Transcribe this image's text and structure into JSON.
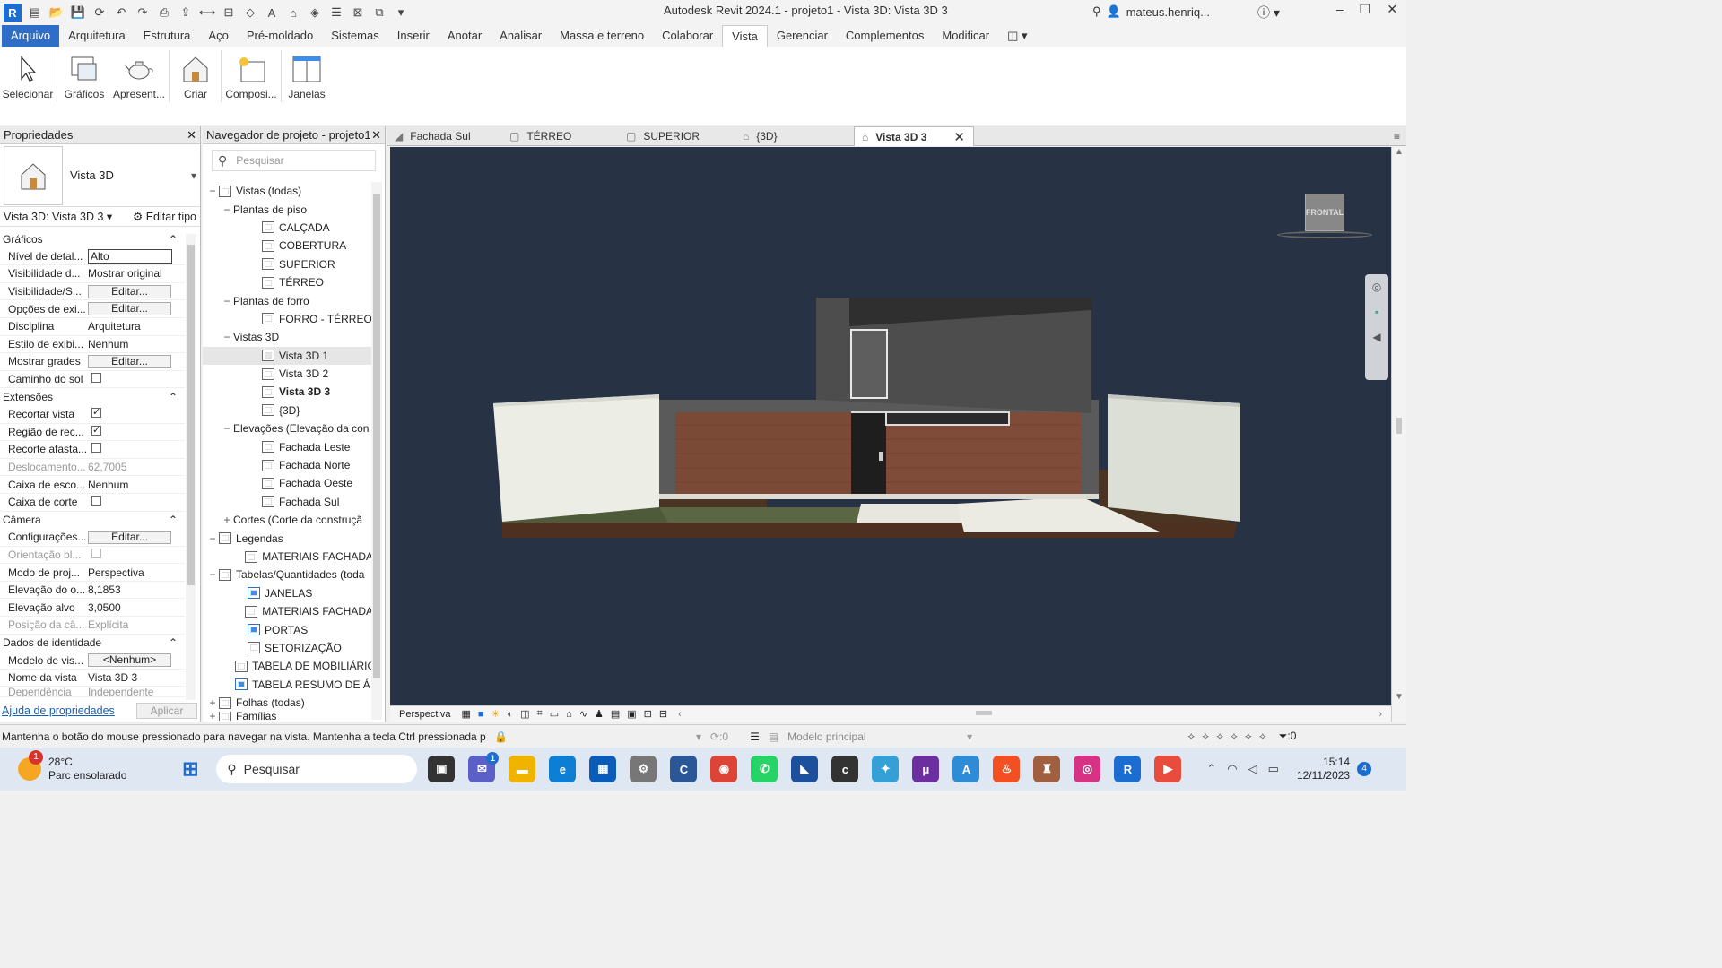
{
  "app": {
    "title": "Autodesk Revit 2024.1 - projeto1 - Vista 3D: Vista 3D 3",
    "user": "mateus.henriq...",
    "logo": "R"
  },
  "tabs": [
    "Arquivo",
    "Arquitetura",
    "Estrutura",
    "Aço",
    "Pré-moldado",
    "Sistemas",
    "Inserir",
    "Anotar",
    "Analisar",
    "Massa e terreno",
    "Colaborar",
    "Vista",
    "Gerenciar",
    "Complementos",
    "Modificar"
  ],
  "active_tab": "Vista",
  "ribbon": [
    "Selecionar",
    "Gráficos",
    "Apresent...",
    "Criar",
    "Composi...",
    "Janelas"
  ],
  "properties": {
    "title": "Propriedades",
    "type_name": "Vista 3D",
    "selector": "Vista 3D: Vista 3D 3",
    "edit_type": "Editar tipo",
    "sections": {
      "graphics": "Gráficos",
      "extents": "Extensões",
      "camera": "Câmera",
      "identity": "Dados de identidade"
    },
    "rows": {
      "detail_level": [
        "Nível de detal...",
        "Alto"
      ],
      "visibility_d": [
        "Visibilidade d...",
        "Mostrar original"
      ],
      "visibility_s": [
        "Visibilidade/S...",
        "Editar..."
      ],
      "display_opts": [
        "Opções de exi...",
        "Editar..."
      ],
      "discipline": [
        "Disciplina",
        "Arquitetura"
      ],
      "display_style": [
        "Estilo de exibi...",
        "Nenhum"
      ],
      "show_grids": [
        "Mostrar grades",
        "Editar..."
      ],
      "sun_path": [
        "Caminho do sol",
        ""
      ],
      "crop_view": [
        "Recortar vista",
        ""
      ],
      "crop_region": [
        "Região de rec...",
        ""
      ],
      "far_clip": [
        "Recorte afasta...",
        ""
      ],
      "offset": [
        "Deslocamento...",
        "62,7005"
      ],
      "scope_box": [
        "Caixa de esco...",
        "Nenhum"
      ],
      "section_box": [
        "Caixa de corte",
        ""
      ],
      "camera_config": [
        "Configurações...",
        "Editar..."
      ],
      "orientation": [
        "Orientação bl...",
        ""
      ],
      "projection": [
        "Modo de proj...",
        "Perspectiva"
      ],
      "eye_elev": [
        "Elevação do o...",
        "8,1853"
      ],
      "target_elev": [
        "Elevação alvo",
        "3,0500"
      ],
      "camera_pos": [
        "Posição da câ...",
        "Explícita"
      ],
      "view_template": [
        "Modelo de vis...",
        "<Nenhum>"
      ],
      "view_name": [
        "Nome da vista",
        "Vista 3D 3"
      ],
      "dependency": [
        "Dependência",
        "Independente"
      ]
    },
    "help": "Ajuda de propriedades",
    "apply": "Aplicar"
  },
  "navigator": {
    "title": "Navegador de projeto - projeto1",
    "search_placeholder": "Pesquisar",
    "items": [
      {
        "label": "Vistas (todas)"
      },
      {
        "label": "Plantas de piso"
      },
      {
        "label": "CALÇADA"
      },
      {
        "label": "COBERTURA"
      },
      {
        "label": "SUPERIOR"
      },
      {
        "label": "TÉRREO"
      },
      {
        "label": "Plantas de forro"
      },
      {
        "label": "FORRO - TÉRREO"
      },
      {
        "label": "Vistas 3D"
      },
      {
        "label": "Vista 3D 1"
      },
      {
        "label": "Vista 3D 2"
      },
      {
        "label": "Vista 3D 3"
      },
      {
        "label": "{3D}"
      },
      {
        "label": "Elevações (Elevação da con"
      },
      {
        "label": "Fachada Leste"
      },
      {
        "label": "Fachada Norte"
      },
      {
        "label": "Fachada Oeste"
      },
      {
        "label": "Fachada Sul"
      },
      {
        "label": "Cortes (Corte da construçã"
      },
      {
        "label": "Legendas"
      },
      {
        "label": "MATERIAIS FACHADA"
      },
      {
        "label": "Tabelas/Quantidades (toda"
      },
      {
        "label": "JANELAS"
      },
      {
        "label": "MATERIAIS FACHADA"
      },
      {
        "label": "PORTAS"
      },
      {
        "label": "SETORIZAÇÃO"
      },
      {
        "label": "TABELA DE MOBILIÁRIO"
      },
      {
        "label": "TABELA RESUMO DE ÁI"
      },
      {
        "label": "Folhas (todas)"
      },
      {
        "label": "Famílias"
      }
    ]
  },
  "view_tabs": [
    "Fachada Sul",
    "TÉRREO",
    "SUPERIOR",
    "{3D}",
    "Vista 3D 3"
  ],
  "viewcube_label": "FRONTAL",
  "view_control": {
    "mode": "Perspectiva"
  },
  "status": {
    "message": "Mantenha o botão do mouse pressionado para navegar na vista. Mantenha a tecla Ctrl pressionada p",
    "count": ":0",
    "model": "Modelo principal",
    "filter": ":0"
  },
  "taskbar": {
    "temp": "28°C",
    "weather": "Parc ensolarado",
    "search": "Pesquisar",
    "time": "15:14",
    "date": "12/11/2023",
    "notif": "4",
    "weather_badge": "1",
    "chat_badge": "1"
  }
}
